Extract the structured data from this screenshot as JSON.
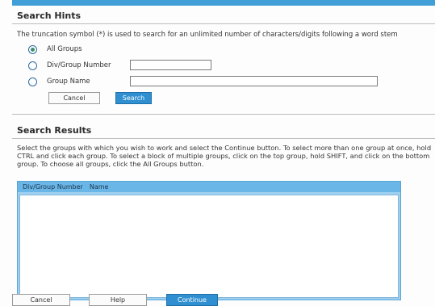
{
  "search_hints": {
    "title": "Search Hints",
    "text": "The truncation symbol (*) is used to search for an unlimited number of characters/digits following a word stem",
    "options": [
      {
        "label": "All Groups",
        "selected": true
      },
      {
        "label": "Div/Group Number",
        "selected": false
      },
      {
        "label": "Group Name",
        "selected": false
      }
    ],
    "div_group_number_value": "",
    "group_name_value": "",
    "cancel_label": "Cancel",
    "search_label": "Search"
  },
  "search_results": {
    "title": "Search Results",
    "instructions": "Select the groups with which you wish to work and select the Continue button. To select more than one group at once, hold CTRL and click each group. To select a block of multiple groups, click on the top group, hold SHIFT, and click on the bottom group. To choose all groups, click the All Groups button.",
    "columns": [
      "Div/Group Number",
      "Name"
    ],
    "rows": []
  },
  "footer": {
    "cancel_label": "Cancel",
    "help_label": "Help",
    "continue_label": "Continue"
  },
  "colors": {
    "accent": "#3f9fd6",
    "primary_button": "#2f8fd0",
    "list_header": "#6ab6e6",
    "list_frame": "#9fd0f0",
    "selected_radio": "#3f8f6b"
  }
}
